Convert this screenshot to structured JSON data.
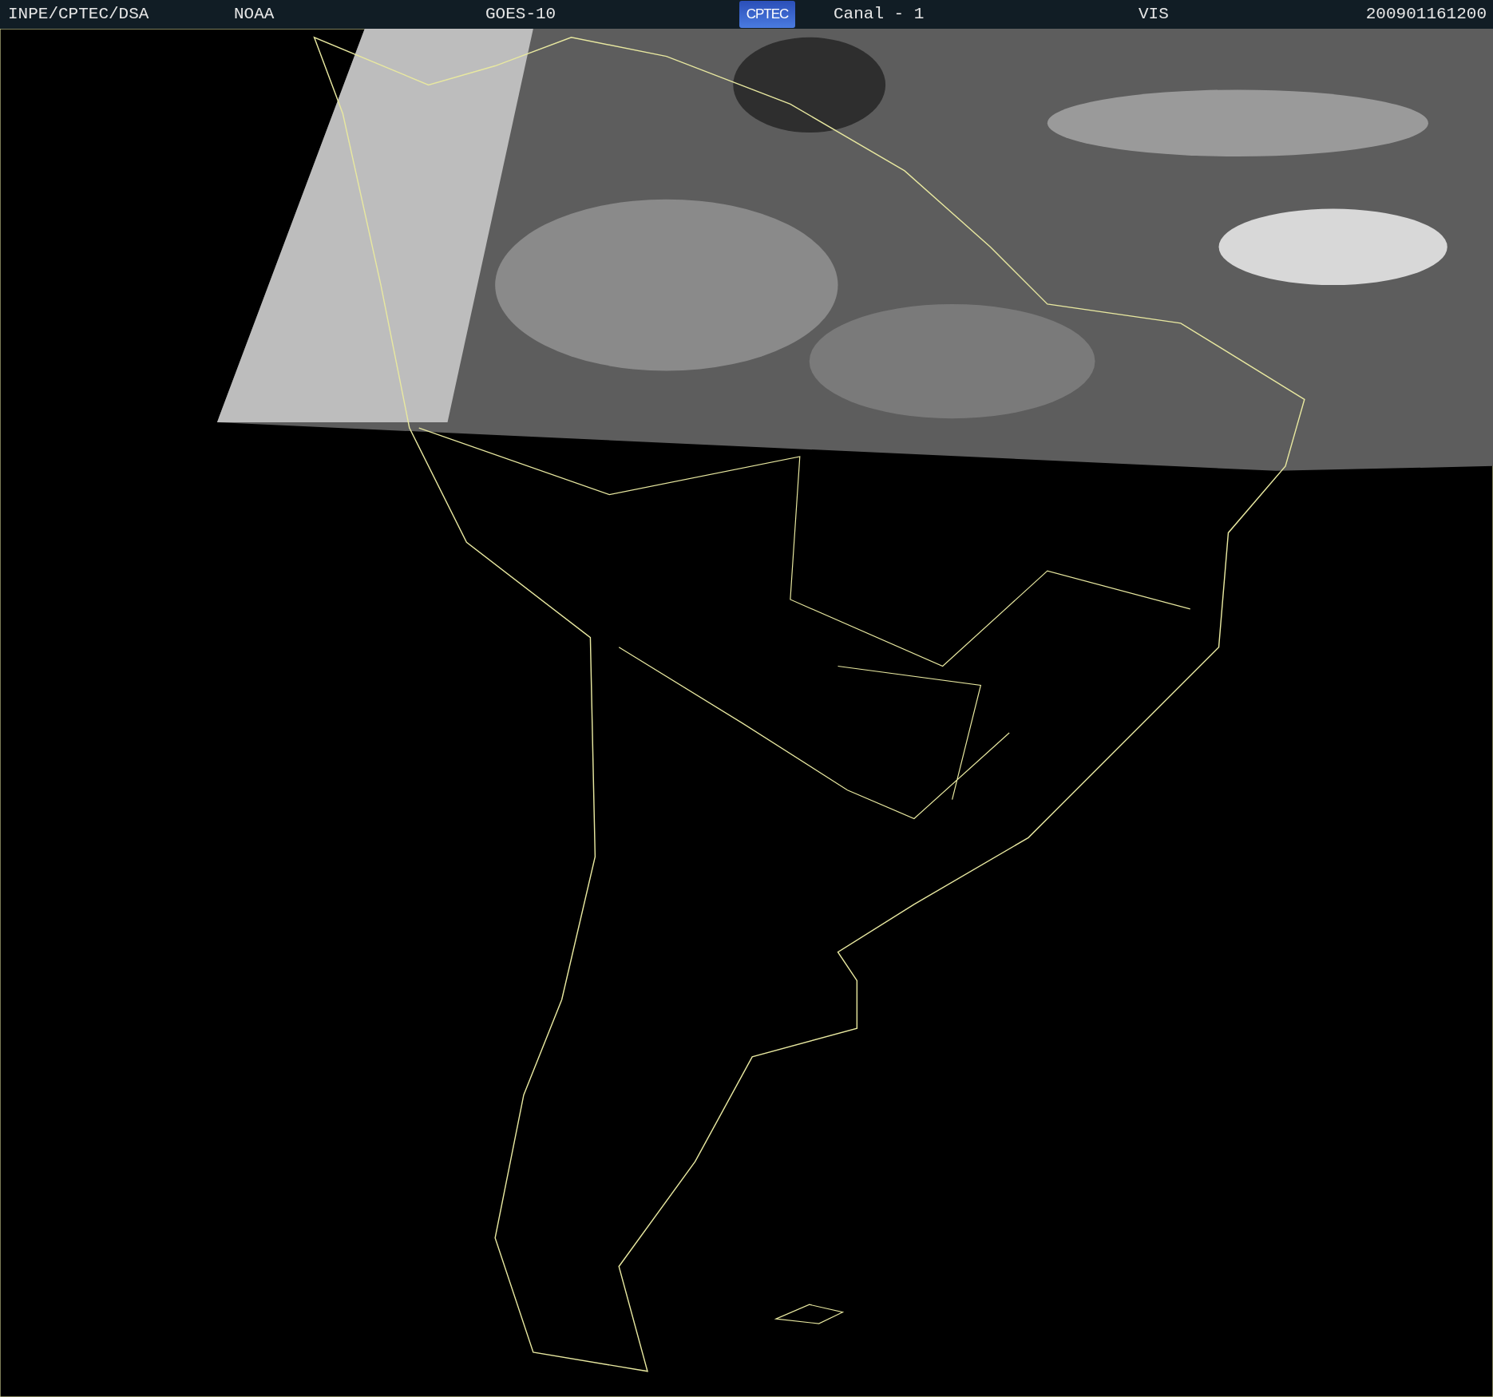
{
  "header": {
    "institution": "INPE/CPTEC/DSA",
    "agency": "NOAA",
    "satellite": "GOES-10",
    "logo": "CPTEC",
    "channel": "Canal - 1",
    "band": "VIS",
    "timestamp": "200901161200"
  }
}
